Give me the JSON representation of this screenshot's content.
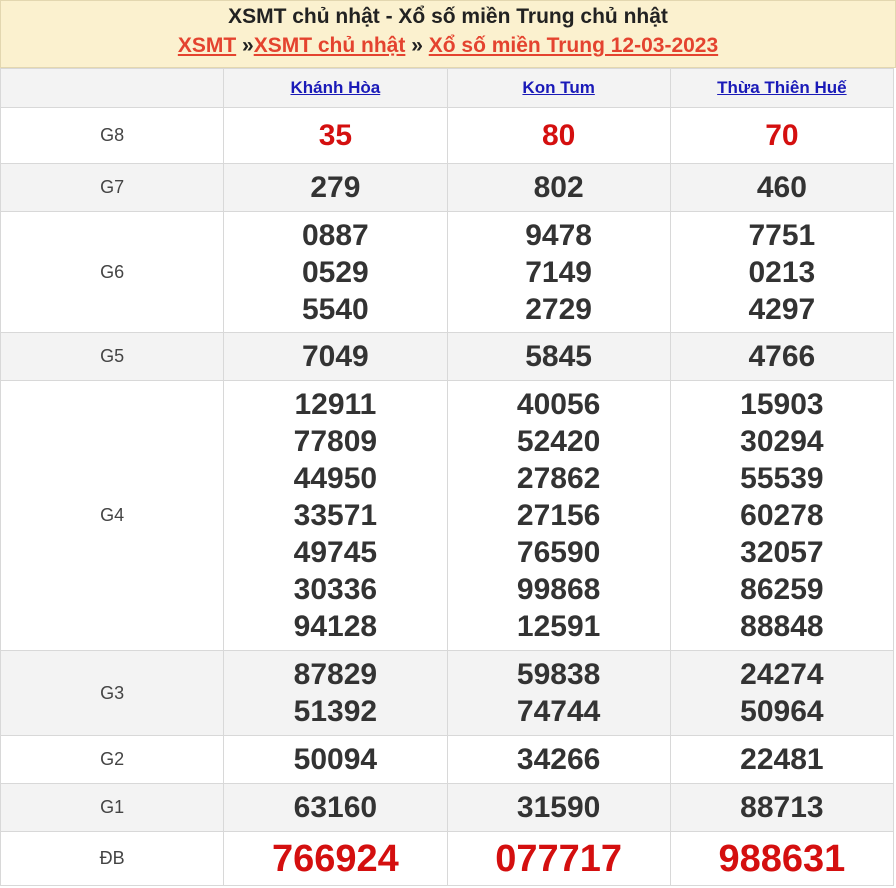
{
  "header": {
    "title": "XSMT chủ nhật - Xổ số miền Trung chủ nhật",
    "crumb1": "XSMT",
    "sep1": " »",
    "crumb2": "XSMT chủ nhật",
    "sep2": " » ",
    "crumb3": "Xổ số miền Trung 12-03-2023"
  },
  "provinces": [
    "Khánh Hòa",
    "Kon Tum",
    "Thừa Thiên Huế"
  ],
  "accent_red": "#d40f0f",
  "link_blue": "#1a1ab8",
  "prizes": [
    {
      "label": "G8",
      "results": [
        [
          "35"
        ],
        [
          "80"
        ],
        [
          "70"
        ]
      ]
    },
    {
      "label": "G7",
      "results": [
        [
          "279"
        ],
        [
          "802"
        ],
        [
          "460"
        ]
      ]
    },
    {
      "label": "G6",
      "results": [
        [
          "0887",
          "0529",
          "5540"
        ],
        [
          "9478",
          "7149",
          "2729"
        ],
        [
          "7751",
          "0213",
          "4297"
        ]
      ]
    },
    {
      "label": "G5",
      "results": [
        [
          "7049"
        ],
        [
          "5845"
        ],
        [
          "4766"
        ]
      ]
    },
    {
      "label": "G4",
      "results": [
        [
          "12911",
          "77809",
          "44950",
          "33571",
          "49745",
          "30336",
          "94128"
        ],
        [
          "40056",
          "52420",
          "27862",
          "27156",
          "76590",
          "99868",
          "12591"
        ],
        [
          "15903",
          "30294",
          "55539",
          "60278",
          "32057",
          "86259",
          "88848"
        ]
      ]
    },
    {
      "label": "G3",
      "results": [
        [
          "87829",
          "51392"
        ],
        [
          "59838",
          "74744"
        ],
        [
          "24274",
          "50964"
        ]
      ]
    },
    {
      "label": "G2",
      "results": [
        [
          "50094"
        ],
        [
          "34266"
        ],
        [
          "22481"
        ]
      ]
    },
    {
      "label": "G1",
      "results": [
        [
          "63160"
        ],
        [
          "31590"
        ],
        [
          "88713"
        ]
      ]
    },
    {
      "label": "ĐB",
      "results": [
        [
          "766924"
        ],
        [
          "077717"
        ],
        [
          "988631"
        ]
      ]
    }
  ]
}
